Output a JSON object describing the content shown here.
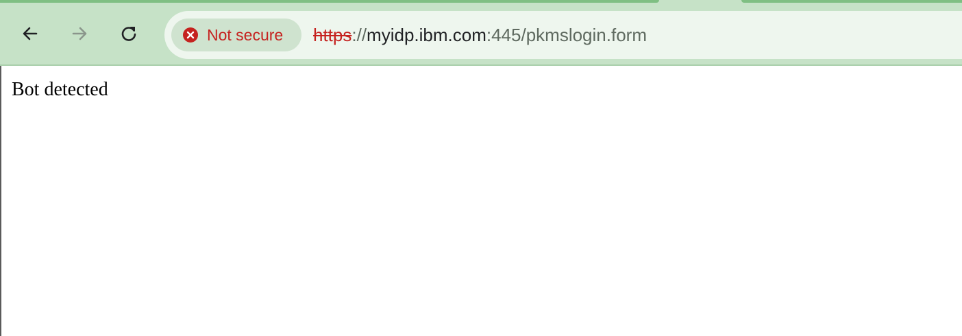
{
  "browser": {
    "nav": {
      "back_icon": "arrow-left-icon",
      "forward_icon": "arrow-right-icon",
      "reload_icon": "reload-icon"
    },
    "security_chip": {
      "icon": "error-circle-icon",
      "label": "Not secure",
      "color": "#c5221f"
    },
    "address": {
      "scheme": "https",
      "separator": "://",
      "host": "myidp.ibm.com",
      "rest": ":445/pkmslogin.form"
    },
    "theme": {
      "toolbar_color": "#c6e2c7",
      "omnibox_color": "#eef6ee",
      "chip_color": "#cfe3cf"
    }
  },
  "page": {
    "body_text": "Bot detected"
  }
}
